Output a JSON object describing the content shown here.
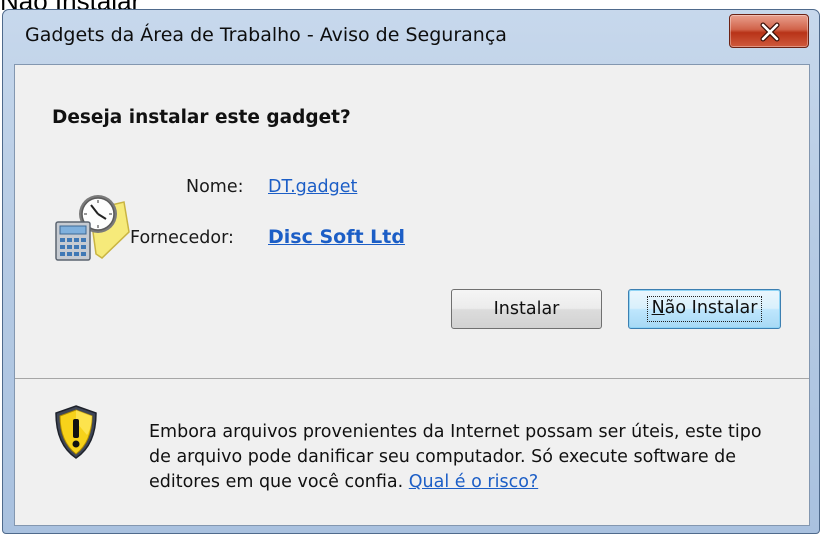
{
  "background_text": "Não Instalar",
  "window": {
    "title": "Gadgets da Área de Trabalho - Aviso de Segurança",
    "close_label": "X"
  },
  "dialog": {
    "heading": "Deseja instalar este gadget?",
    "name_label": "Nome:",
    "name_value": "DT.gadget",
    "publisher_label": "Fornecedor:",
    "publisher_value": "Disc Soft Ltd"
  },
  "buttons": {
    "install": "Instalar",
    "dont_install_mnemonic": "N",
    "dont_install_rest": "ão Instalar"
  },
  "warning": {
    "text": "Embora arquivos provenientes da Internet possam ser úteis, este tipo de arquivo pode danificar seu computador. Só execute software de editores em que você confia. ",
    "link": "Qual é o risco?"
  },
  "icons": {
    "gadget": "gadget-calculator-clock-icon",
    "shield": "security-shield-warning-icon",
    "close": "close-icon"
  },
  "colors": {
    "link": "#1c5ec6",
    "close_button": "#c7442a",
    "client_bg": "#f0f0f0"
  }
}
